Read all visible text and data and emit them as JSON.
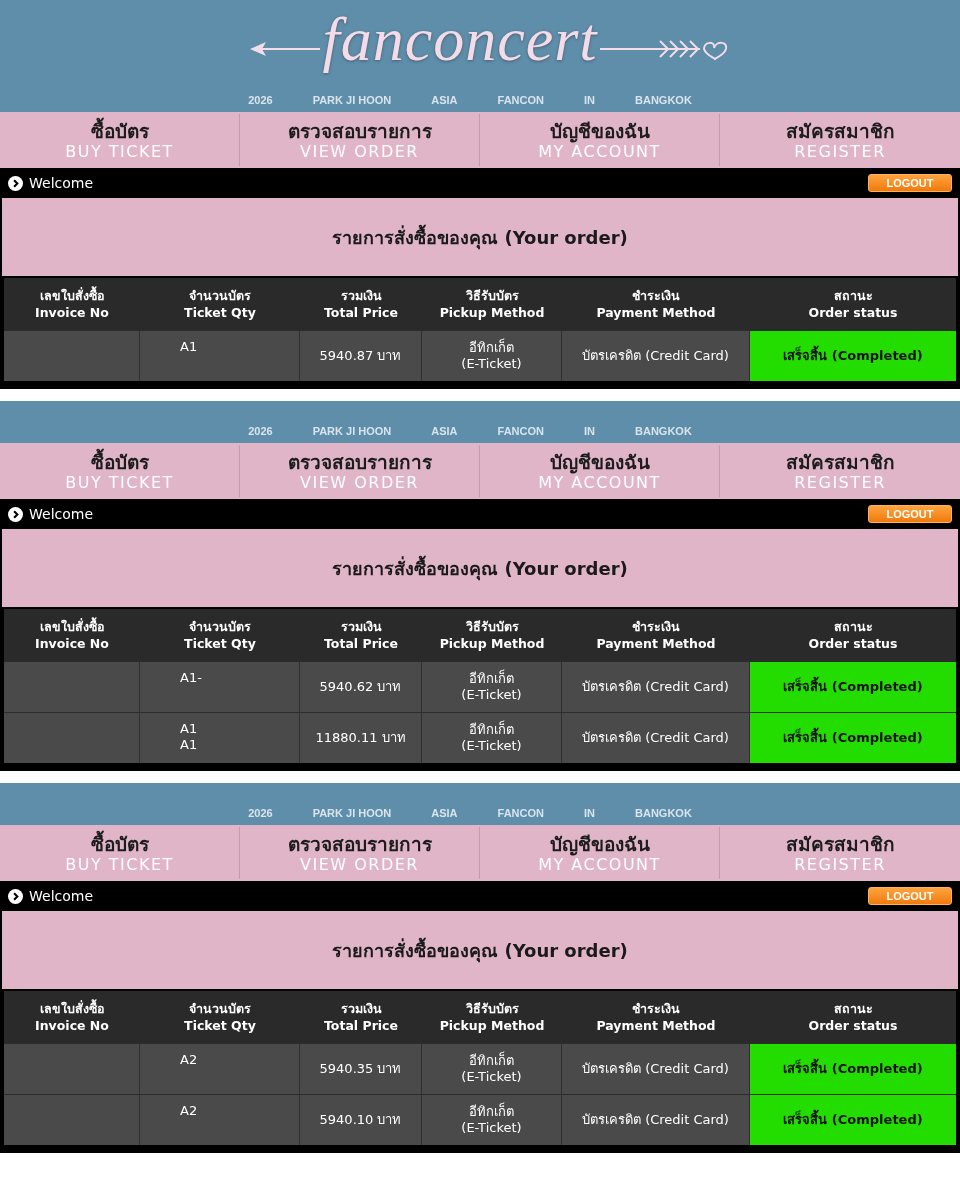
{
  "panels": [
    {
      "banner": {
        "logo": "fanconcert",
        "tagline": [
          "2026",
          "PARK JI HOON",
          "ASIA",
          "FANCON",
          "IN",
          "BANGKOK"
        ]
      },
      "nav": [
        {
          "thai": "ซื้อบัตร",
          "english": "BUY TICKET"
        },
        {
          "thai": "ตรวจสอบรายการ",
          "english": "VIEW ORDER"
        },
        {
          "thai": "บัญชีของฉัน",
          "english": "MY ACCOUNT"
        },
        {
          "thai": "สมัครสมาชิก",
          "english": "REGISTER"
        }
      ],
      "welcome": "Welcome",
      "logout": "LOGOUT",
      "order_title": "รายการสั่งซื้อของคุณ (Your order)",
      "table": {
        "columns": [
          {
            "thai": "เลขใบสั่งซื้อ",
            "english": "Invoice No"
          },
          {
            "thai": "จำนวนบัตร",
            "english": "Ticket Qty"
          },
          {
            "thai": "รวมเงิน",
            "english": "Total Price"
          },
          {
            "thai": "วิธีรับบัตร",
            "english": "Pickup Method"
          },
          {
            "thai": "ชำระเงิน",
            "english": "Payment Method"
          },
          {
            "thai": "สถานะ",
            "english": "Order status"
          }
        ],
        "rows": [
          {
            "ticket_qty": "A1",
            "total_price": "5940.87 บาท",
            "pickup_method": "อีทิกเก็ต\n(E-Ticket)",
            "payment_method": "บัตรเครดิต (Credit Card)",
            "order_status": "เสร็จสิ้น (Completed)"
          }
        ]
      }
    },
    {
      "banner": {
        "tagline": [
          "2026",
          "PARK JI HOON",
          "ASIA",
          "FANCON",
          "IN",
          "BANGKOK"
        ]
      },
      "nav": [
        {
          "thai": "ซื้อบัตร",
          "english": "BUY TICKET"
        },
        {
          "thai": "ตรวจสอบรายการ",
          "english": "VIEW ORDER"
        },
        {
          "thai": "บัญชีของฉัน",
          "english": "MY ACCOUNT"
        },
        {
          "thai": "สมัครสมาชิก",
          "english": "REGISTER"
        }
      ],
      "welcome": "Welcome",
      "logout": "LOGOUT",
      "order_title": "รายการสั่งซื้อของคุณ (Your order)",
      "table": {
        "columns": [
          {
            "thai": "เลขใบสั่งซื้อ",
            "english": "Invoice No"
          },
          {
            "thai": "จำนวนบัตร",
            "english": "Ticket Qty"
          },
          {
            "thai": "รวมเงิน",
            "english": "Total Price"
          },
          {
            "thai": "วิธีรับบัตร",
            "english": "Pickup Method"
          },
          {
            "thai": "ชำระเงิน",
            "english": "Payment Method"
          },
          {
            "thai": "สถานะ",
            "english": "Order status"
          }
        ],
        "rows": [
          {
            "ticket_qty": "A1-",
            "total_price": "5940.62 บาท",
            "pickup_method": "อีทิกเก็ต\n(E-Ticket)",
            "payment_method": "บัตรเครดิต (Credit Card)",
            "order_status": "เสร็จสิ้น (Completed)"
          },
          {
            "ticket_qty": "A1\nA1",
            "total_price": "11880.11 บาท",
            "pickup_method": "อีทิกเก็ต\n(E-Ticket)",
            "payment_method": "บัตรเครดิต (Credit Card)",
            "order_status": "เสร็จสิ้น (Completed)"
          }
        ]
      }
    },
    {
      "banner": {
        "tagline": [
          "2026",
          "PARK JI HOON",
          "ASIA",
          "FANCON",
          "IN",
          "BANGKOK"
        ]
      },
      "nav": [
        {
          "thai": "ซื้อบัตร",
          "english": "BUY TICKET"
        },
        {
          "thai": "ตรวจสอบรายการ",
          "english": "VIEW ORDER"
        },
        {
          "thai": "บัญชีของฉัน",
          "english": "MY ACCOUNT"
        },
        {
          "thai": "สมัครสมาชิก",
          "english": "REGISTER"
        }
      ],
      "welcome": "Welcome",
      "logout": "LOGOUT",
      "order_title": "รายการสั่งซื้อของคุณ (Your order)",
      "table": {
        "columns": [
          {
            "thai": "เลขใบสั่งซื้อ",
            "english": "Invoice No"
          },
          {
            "thai": "จำนวนบัตร",
            "english": "Ticket Qty"
          },
          {
            "thai": "รวมเงิน",
            "english": "Total Price"
          },
          {
            "thai": "วิธีรับบัตร",
            "english": "Pickup Method"
          },
          {
            "thai": "ชำระเงิน",
            "english": "Payment Method"
          },
          {
            "thai": "สถานะ",
            "english": "Order status"
          }
        ],
        "rows": [
          {
            "ticket_qty": "A2",
            "total_price": "5940.35 บาท",
            "pickup_method": "อีทิกเก็ต\n(E-Ticket)",
            "payment_method": "บัตรเครดิต (Credit Card)",
            "order_status": "เสร็จสิ้น (Completed)"
          },
          {
            "ticket_qty": "A2",
            "total_price": "5940.10 บาท",
            "pickup_method": "อีทิกเก็ต\n(E-Ticket)",
            "payment_method": "บัตรเครดิต (Credit Card)",
            "order_status": "เสร็จสิ้น (Completed)"
          }
        ]
      }
    }
  ]
}
